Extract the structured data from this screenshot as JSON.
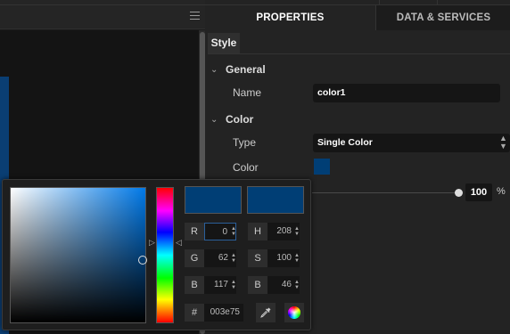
{
  "tabs": {
    "properties": "PROPERTIES",
    "data_services": "DATA & SERVICES"
  },
  "style_tab": "Style",
  "general": {
    "title": "General",
    "name_label": "Name",
    "name_value": "color1"
  },
  "color_section": {
    "title": "Color",
    "type_label": "Type",
    "type_value": "Single Color",
    "color_label": "Color",
    "color_hex": "#003e75"
  },
  "opacity": {
    "value": "100",
    "unit": "%"
  },
  "picker": {
    "fields": {
      "r_label": "R",
      "r_value": "0",
      "g_label": "G",
      "g_value": "62",
      "b_label": "B",
      "b_value": "117",
      "h_label": "H",
      "h_value": "208",
      "s_label": "S",
      "s_value": "100",
      "v_label": "B",
      "v_value": "46",
      "hex_label": "#",
      "hex_value": "003e75"
    },
    "icons": {
      "menu": "hamburger-menu-icon",
      "eyedropper": "eyedropper-icon",
      "wheel": "color-wheel-icon"
    }
  }
}
